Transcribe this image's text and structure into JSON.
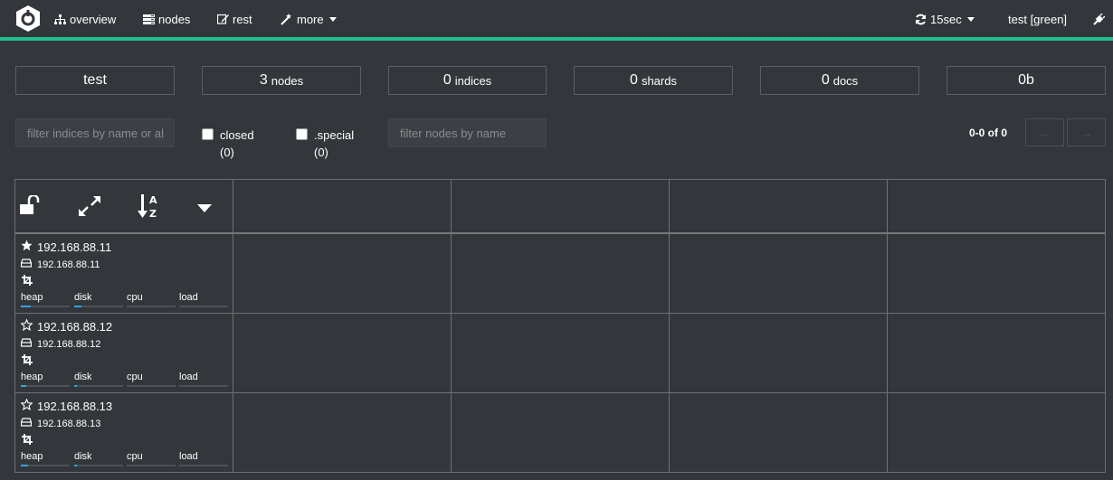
{
  "nav": {
    "items": [
      {
        "label": "overview",
        "icon": "sitemap-icon"
      },
      {
        "label": "nodes",
        "icon": "server-icon"
      },
      {
        "label": "rest",
        "icon": "edit-icon"
      },
      {
        "label": "more",
        "icon": "magic-wand-icon"
      }
    ],
    "refresh_label": "15sec",
    "cluster_label": "test [green]",
    "accent_color": "#1ec08c"
  },
  "stats": {
    "cluster": "test",
    "nodes_value": "3",
    "nodes_unit": "nodes",
    "indices_value": "0",
    "indices_unit": "indices",
    "shards_value": "0",
    "shards_unit": "shards",
    "docs_value": "0",
    "docs_unit": "docs",
    "size": "0b"
  },
  "filters": {
    "indices_placeholder": "filter indices by name or al",
    "closed_label": "closed",
    "closed_count": "(0)",
    "special_label": ".special",
    "special_count": "(0)",
    "nodes_placeholder": "filter nodes by name",
    "pager": "0-0 of 0"
  },
  "nodes": [
    {
      "name": "192.168.88.11",
      "address": "192.168.88.11",
      "master": true,
      "metrics": [
        {
          "label": "heap",
          "fill": 0.2
        },
        {
          "label": "disk",
          "fill": 0.15
        },
        {
          "label": "cpu",
          "fill": 0
        },
        {
          "label": "load",
          "fill": 0
        }
      ]
    },
    {
      "name": "192.168.88.12",
      "address": "192.168.88.12",
      "master": false,
      "metrics": [
        {
          "label": "heap",
          "fill": 0.12
        },
        {
          "label": "disk",
          "fill": 0.06
        },
        {
          "label": "cpu",
          "fill": 0
        },
        {
          "label": "load",
          "fill": 0
        }
      ]
    },
    {
      "name": "192.168.88.13",
      "address": "192.168.88.13",
      "master": false,
      "metrics": [
        {
          "label": "heap",
          "fill": 0.15
        },
        {
          "label": "disk",
          "fill": 0.06
        },
        {
          "label": "cpu",
          "fill": 0
        },
        {
          "label": "load",
          "fill": 0
        }
      ]
    }
  ]
}
